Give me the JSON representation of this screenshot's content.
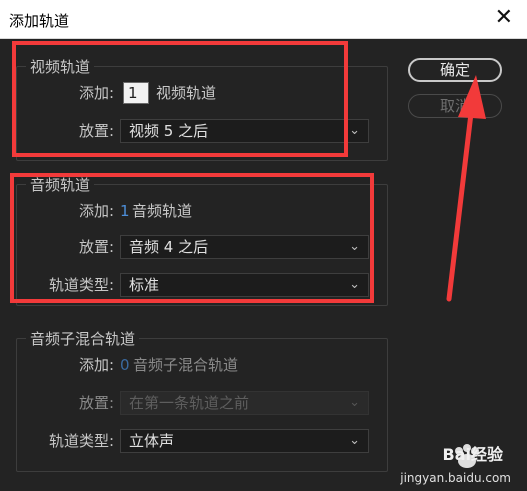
{
  "window": {
    "title": "添加轨道",
    "close": "✕"
  },
  "video_track": {
    "legend": "视频轨道",
    "add_label": "添加:",
    "count": "1",
    "count_suffix": "视频轨道",
    "placement_label": "放置:",
    "placement_value": "视频 5 之后"
  },
  "audio_track": {
    "legend": "音频轨道",
    "add_label": "添加:",
    "count": "1",
    "count_suffix": "音频轨道",
    "placement_label": "放置:",
    "placement_value": "音频 4 之后",
    "type_label": "轨道类型:",
    "type_value": "标准"
  },
  "submix_track": {
    "legend": "音频子混合轨道",
    "add_label": "添加:",
    "count": "0",
    "count_suffix": "音频子混合轨道",
    "placement_label": "放置:",
    "placement_value": "在第一条轨道之前",
    "type_label": "轨道类型:",
    "type_value": "立体声"
  },
  "buttons": {
    "ok": "确定",
    "cancel": "取消"
  },
  "chevron_icon": "⌄",
  "watermark": {
    "brand": "Bai经验",
    "url": "jingyan.baidu.com"
  },
  "colors": {
    "dialog_bg": "#232323",
    "annotation_red": "#f23a3a",
    "count_blue": "#4d8ed8"
  }
}
